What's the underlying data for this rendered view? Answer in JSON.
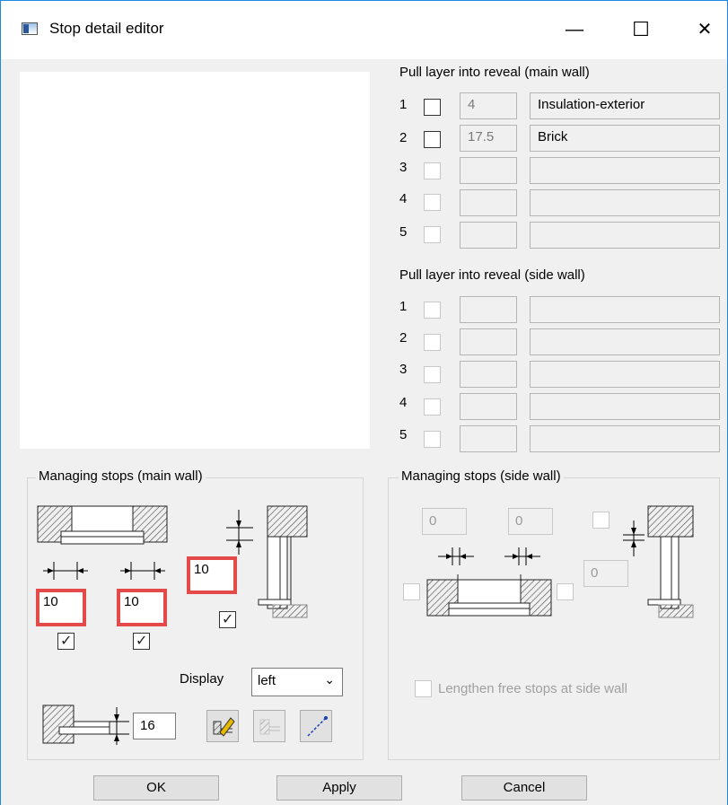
{
  "window": {
    "title": "Stop detail editor",
    "minimize_glyph": "—",
    "maximize_glyph": "☐",
    "close_glyph": "✕"
  },
  "main_wall_layers": {
    "title": "Pull layer into reveal (main wall)",
    "rows": [
      {
        "num": "1",
        "checked": false,
        "enabled": true,
        "thickness": "4",
        "name": "Insulation-exterior"
      },
      {
        "num": "2",
        "checked": false,
        "enabled": true,
        "thickness": "17.5",
        "name": "Brick"
      },
      {
        "num": "3",
        "checked": false,
        "enabled": false,
        "thickness": "",
        "name": ""
      },
      {
        "num": "4",
        "checked": false,
        "enabled": false,
        "thickness": "",
        "name": ""
      },
      {
        "num": "5",
        "checked": false,
        "enabled": false,
        "thickness": "",
        "name": ""
      }
    ]
  },
  "side_wall_layers": {
    "title": "Pull layer into reveal (side wall)",
    "rows": [
      {
        "num": "1",
        "checked": false,
        "enabled": false,
        "thickness": "",
        "name": ""
      },
      {
        "num": "2",
        "checked": false,
        "enabled": false,
        "thickness": "",
        "name": ""
      },
      {
        "num": "3",
        "checked": false,
        "enabled": false,
        "thickness": "",
        "name": ""
      },
      {
        "num": "4",
        "checked": false,
        "enabled": false,
        "thickness": "",
        "name": ""
      },
      {
        "num": "5",
        "checked": false,
        "enabled": false,
        "thickness": "",
        "name": ""
      }
    ]
  },
  "main_stops": {
    "title": "Managing stops (main wall)",
    "left_value": "10",
    "right_value": "10",
    "depth_value": "10",
    "left_checked": true,
    "right_checked": true,
    "depth_checked": true,
    "display_label": "Display",
    "display_value": "left",
    "offset_value": "16",
    "icons": [
      "edit-pencil-icon",
      "stop-disabled-icon",
      "diagonal-line-icon"
    ]
  },
  "side_stops": {
    "title": "Managing stops (side wall)",
    "left_value": "0",
    "right_value": "0",
    "depth_value": "0",
    "lengthen_label": "Lengthen free stops at side wall"
  },
  "buttons": {
    "ok": "OK",
    "apply": "Apply",
    "cancel": "Cancel"
  }
}
